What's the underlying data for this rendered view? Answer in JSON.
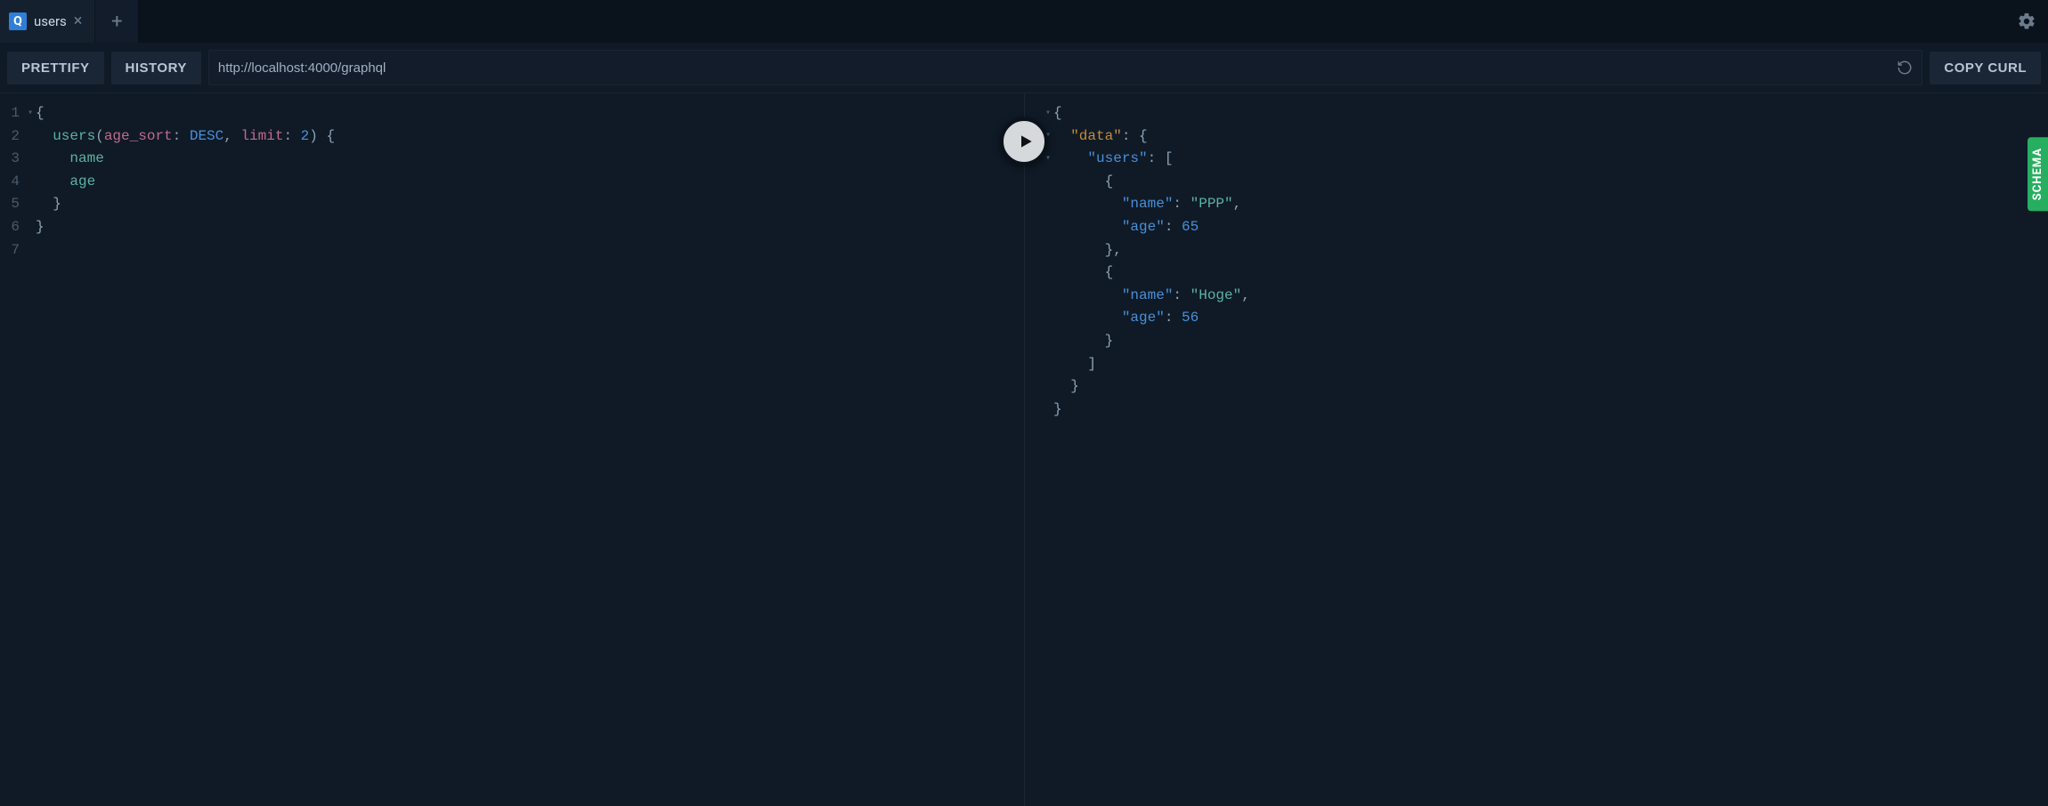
{
  "tabs": {
    "active_badge": "Q",
    "active_label": "users",
    "add_tooltip": "+"
  },
  "toolbar": {
    "prettify_label": "PRETTIFY",
    "history_label": "HISTORY",
    "endpoint_url": "http://localhost:4000/graphql",
    "copy_curl_label": "COPY CURL"
  },
  "query": {
    "line_numbers": [
      "1",
      "2",
      "3",
      "4",
      "5",
      "6",
      "7"
    ],
    "folds": [
      "▾",
      "",
      "",
      "",
      "",
      "",
      ""
    ],
    "text_raw": "{\n  users(age_sort: DESC, limit: 2) {\n    name\n    age\n  }\n}\n",
    "tokens": [
      [
        {
          "t": "punc",
          "v": "{"
        }
      ],
      [
        {
          "t": "sp",
          "v": "  "
        },
        {
          "t": "field",
          "v": "users"
        },
        {
          "t": "punc",
          "v": "("
        },
        {
          "t": "arg",
          "v": "age_sort"
        },
        {
          "t": "punc",
          "v": ": "
        },
        {
          "t": "enum",
          "v": "DESC"
        },
        {
          "t": "punc",
          "v": ", "
        },
        {
          "t": "arg",
          "v": "limit"
        },
        {
          "t": "punc",
          "v": ": "
        },
        {
          "t": "num",
          "v": "2"
        },
        {
          "t": "punc",
          "v": ") {"
        }
      ],
      [
        {
          "t": "sp",
          "v": "    "
        },
        {
          "t": "field",
          "v": "name"
        }
      ],
      [
        {
          "t": "sp",
          "v": "    "
        },
        {
          "t": "field",
          "v": "age"
        }
      ],
      [
        {
          "t": "sp",
          "v": "  "
        },
        {
          "t": "punc",
          "v": "}"
        }
      ],
      [
        {
          "t": "punc",
          "v": "}"
        }
      ],
      []
    ]
  },
  "response": {
    "folds": [
      "▾",
      "▾",
      "▾",
      "",
      "",
      "",
      "",
      "",
      "",
      "",
      "",
      "",
      "",
      ""
    ],
    "json_raw": "{\n  \"data\": {\n    \"users\": [\n      {\n        \"name\": \"PPP\",\n        \"age\": 65\n      },\n      {\n        \"name\": \"Hoge\",\n        \"age\": 56\n      }\n    ]\n  }\n}",
    "tokens": [
      [
        {
          "t": "punc",
          "v": "{"
        }
      ],
      [
        {
          "t": "sp",
          "v": "  "
        },
        {
          "t": "top",
          "v": "\"data\""
        },
        {
          "t": "punc",
          "v": ": {"
        }
      ],
      [
        {
          "t": "sp",
          "v": "    "
        },
        {
          "t": "key",
          "v": "\"users\""
        },
        {
          "t": "punc",
          "v": ": ["
        }
      ],
      [
        {
          "t": "sp",
          "v": "      "
        },
        {
          "t": "punc",
          "v": "{"
        }
      ],
      [
        {
          "t": "sp",
          "v": "        "
        },
        {
          "t": "key",
          "v": "\"name\""
        },
        {
          "t": "punc",
          "v": ": "
        },
        {
          "t": "str",
          "v": "\"PPP\""
        },
        {
          "t": "punc",
          "v": ","
        }
      ],
      [
        {
          "t": "sp",
          "v": "        "
        },
        {
          "t": "key",
          "v": "\"age\""
        },
        {
          "t": "punc",
          "v": ": "
        },
        {
          "t": "num",
          "v": "65"
        }
      ],
      [
        {
          "t": "sp",
          "v": "      "
        },
        {
          "t": "punc",
          "v": "},"
        }
      ],
      [
        {
          "t": "sp",
          "v": "      "
        },
        {
          "t": "punc",
          "v": "{"
        }
      ],
      [
        {
          "t": "sp",
          "v": "        "
        },
        {
          "t": "key",
          "v": "\"name\""
        },
        {
          "t": "punc",
          "v": ": "
        },
        {
          "t": "str",
          "v": "\"Hoge\""
        },
        {
          "t": "punc",
          "v": ","
        }
      ],
      [
        {
          "t": "sp",
          "v": "        "
        },
        {
          "t": "key",
          "v": "\"age\""
        },
        {
          "t": "punc",
          "v": ": "
        },
        {
          "t": "num",
          "v": "56"
        }
      ],
      [
        {
          "t": "sp",
          "v": "      "
        },
        {
          "t": "punc",
          "v": "}"
        }
      ],
      [
        {
          "t": "sp",
          "v": "    "
        },
        {
          "t": "punc",
          "v": "]"
        }
      ],
      [
        {
          "t": "sp",
          "v": "  "
        },
        {
          "t": "punc",
          "v": "}"
        }
      ],
      [
        {
          "t": "punc",
          "v": "}"
        }
      ]
    ]
  },
  "schema_tab_label": "SCHEMA"
}
